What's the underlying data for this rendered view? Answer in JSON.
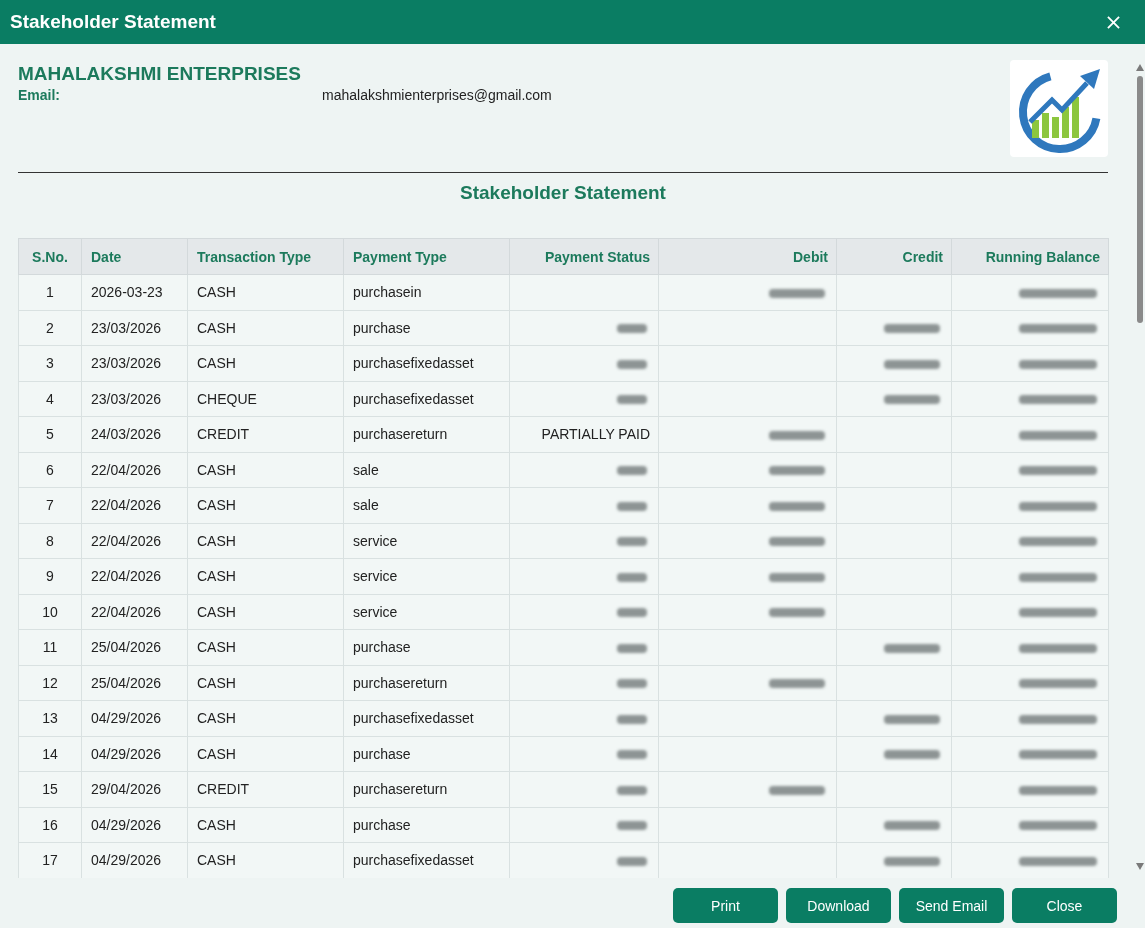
{
  "window": {
    "title": "Stakeholder Statement"
  },
  "company": {
    "name": "MAHALAKSHMI ENTERPRISES",
    "email_label": "Email:",
    "email": "mahalakshmienterprises@gmail.com"
  },
  "statement": {
    "heading": "Stakeholder Statement"
  },
  "table": {
    "columns": [
      "S.No.",
      "Date",
      "Transaction Type",
      "Payment Type",
      "Payment Status",
      "Debit",
      "Credit",
      "Running Balance"
    ],
    "rows": [
      {
        "sno": "1",
        "date": "2026-03-23",
        "transaction_type": "CASH",
        "payment_type": "purchasein",
        "status_blurred": false,
        "debit_blurred": true,
        "credit_blurred": false,
        "balance_blurred": true
      },
      {
        "sno": "2",
        "date": "23/03/2026",
        "transaction_type": "CASH",
        "payment_type": "purchase",
        "status_blurred": true,
        "debit_blurred": false,
        "credit_blurred": true,
        "balance_blurred": true
      },
      {
        "sno": "3",
        "date": "23/03/2026",
        "transaction_type": "CASH",
        "payment_type": "purchasefixedasset",
        "status_blurred": true,
        "debit_blurred": false,
        "credit_blurred": true,
        "balance_blurred": true
      },
      {
        "sno": "4",
        "date": "23/03/2026",
        "transaction_type": "CHEQUE",
        "payment_type": "purchasefixedasset",
        "status_blurred": true,
        "debit_blurred": false,
        "credit_blurred": true,
        "balance_blurred": true
      },
      {
        "sno": "5",
        "date": "24/03/2026",
        "transaction_type": "CREDIT",
        "payment_type": "purchasereturn",
        "payment_status": "PARTIALLY PAID",
        "status_blurred": false,
        "debit_blurred": true,
        "credit_blurred": false,
        "balance_blurred": true
      },
      {
        "sno": "6",
        "date": "22/04/2026",
        "transaction_type": "CASH",
        "payment_type": "sale",
        "status_blurred": true,
        "debit_blurred": true,
        "credit_blurred": false,
        "balance_blurred": true
      },
      {
        "sno": "7",
        "date": "22/04/2026",
        "transaction_type": "CASH",
        "payment_type": "sale",
        "status_blurred": true,
        "debit_blurred": true,
        "credit_blurred": false,
        "balance_blurred": true
      },
      {
        "sno": "8",
        "date": "22/04/2026",
        "transaction_type": "CASH",
        "payment_type": "service",
        "status_blurred": true,
        "debit_blurred": true,
        "credit_blurred": false,
        "balance_blurred": true
      },
      {
        "sno": "9",
        "date": "22/04/2026",
        "transaction_type": "CASH",
        "payment_type": "service",
        "status_blurred": true,
        "debit_blurred": true,
        "credit_blurred": false,
        "balance_blurred": true
      },
      {
        "sno": "10",
        "date": "22/04/2026",
        "transaction_type": "CASH",
        "payment_type": "service",
        "status_blurred": true,
        "debit_blurred": true,
        "credit_blurred": false,
        "balance_blurred": true
      },
      {
        "sno": "11",
        "date": "25/04/2026",
        "transaction_type": "CASH",
        "payment_type": "purchase",
        "status_blurred": true,
        "debit_blurred": false,
        "credit_blurred": true,
        "balance_blurred": true
      },
      {
        "sno": "12",
        "date": "25/04/2026",
        "transaction_type": "CASH",
        "payment_type": "purchasereturn",
        "status_blurred": true,
        "debit_blurred": true,
        "credit_blurred": false,
        "balance_blurred": true
      },
      {
        "sno": "13",
        "date": "04/29/2026",
        "transaction_type": "CASH",
        "payment_type": "purchasefixedasset",
        "status_blurred": true,
        "debit_blurred": false,
        "credit_blurred": true,
        "balance_blurred": true
      },
      {
        "sno": "14",
        "date": "04/29/2026",
        "transaction_type": "CASH",
        "payment_type": "purchase",
        "status_blurred": true,
        "debit_blurred": false,
        "credit_blurred": true,
        "balance_blurred": true
      },
      {
        "sno": "15",
        "date": "29/04/2026",
        "transaction_type": "CREDIT",
        "payment_type": "purchasereturn",
        "status_blurred": true,
        "debit_blurred": true,
        "credit_blurred": false,
        "balance_blurred": true
      },
      {
        "sno": "16",
        "date": "04/29/2026",
        "transaction_type": "CASH",
        "payment_type": "purchase",
        "status_blurred": true,
        "debit_blurred": false,
        "credit_blurred": true,
        "balance_blurred": true
      },
      {
        "sno": "17",
        "date": "04/29/2026",
        "transaction_type": "CASH",
        "payment_type": "purchasefixedasset",
        "status_blurred": true,
        "debit_blurred": false,
        "credit_blurred": true,
        "balance_blurred": true
      }
    ]
  },
  "buttons": [
    {
      "label": "Print"
    },
    {
      "label": "Download"
    },
    {
      "label": "Send Email"
    },
    {
      "label": "Close"
    }
  ]
}
